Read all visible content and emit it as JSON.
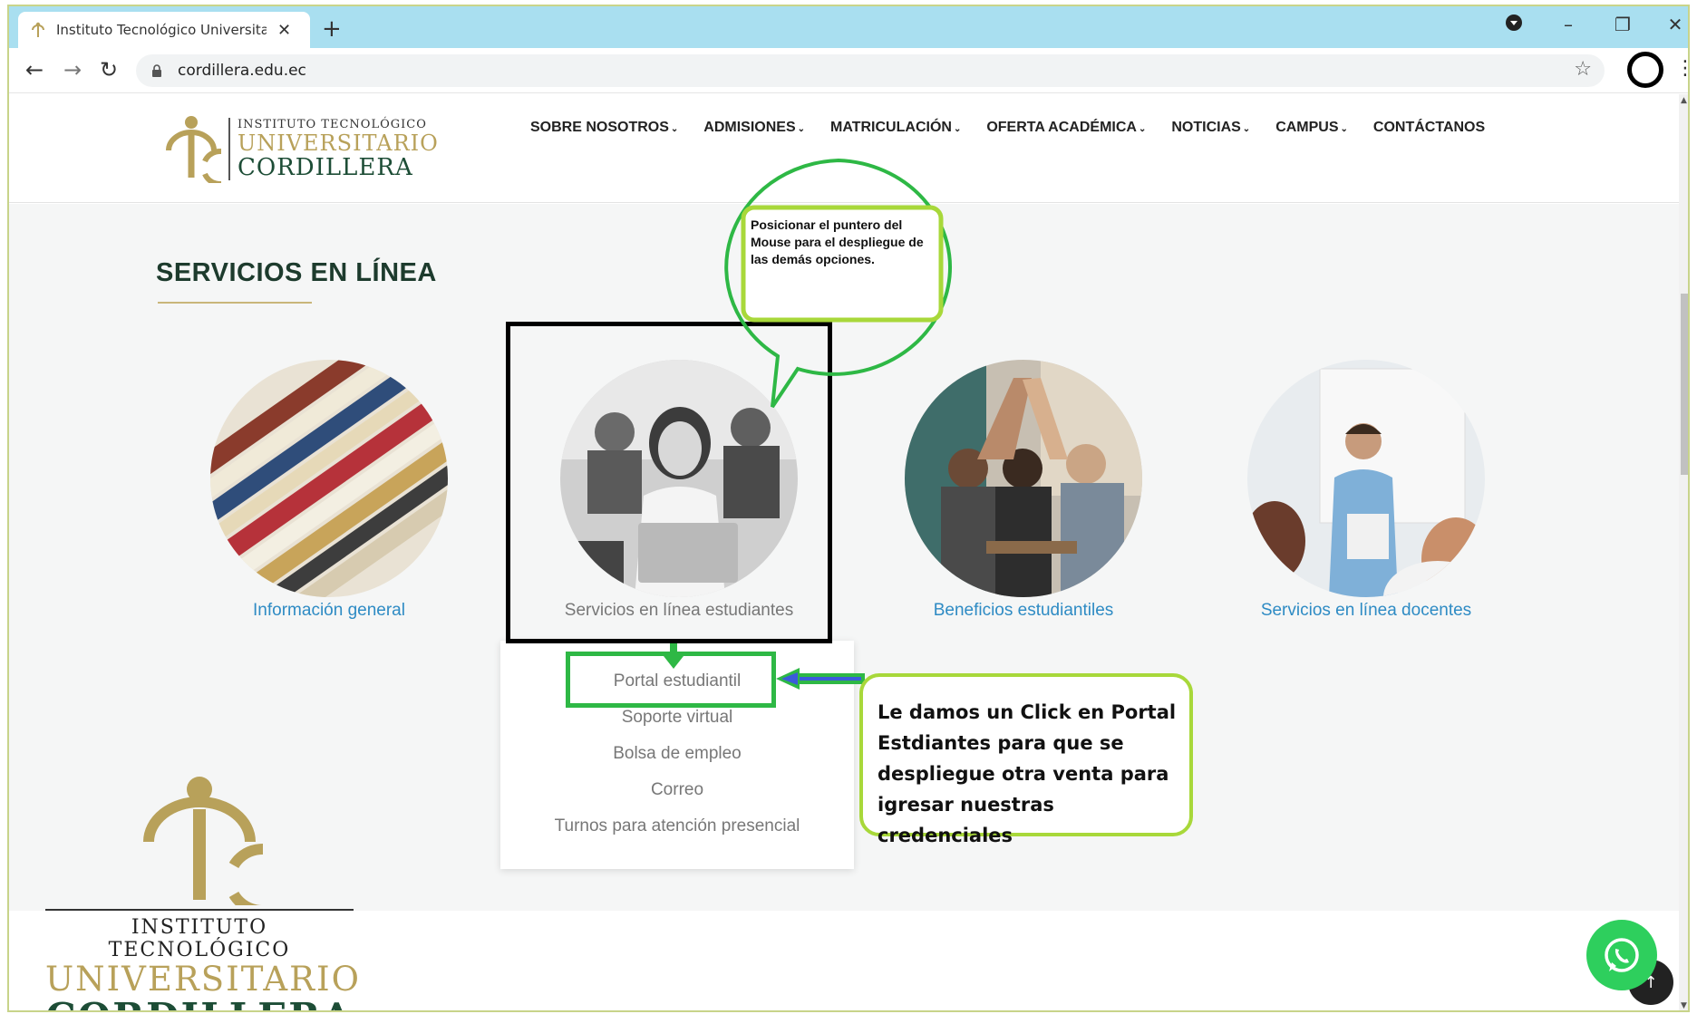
{
  "browser": {
    "tab_title": "Instituto Tecnológico Universitari",
    "tab_close": "✕",
    "new_tab": "+",
    "url": "cordillera.edu.ec",
    "nav_back": "←",
    "nav_forward": "→",
    "nav_reload": "↻",
    "star": "☆",
    "kebab": "⋮",
    "minimize": "–",
    "restore": "❐",
    "close": "✕",
    "colors": {
      "tabbar": "#a9dff0"
    }
  },
  "header": {
    "logo_line1": "INSTITUTO TECNOLÓGICO",
    "logo_line2": "UNIVERSITARIO",
    "logo_line3": "CORDILLERA",
    "nav": [
      {
        "label": "SOBRE NOSOTROS",
        "has_caret": true
      },
      {
        "label": "ADMISIONES",
        "has_caret": true
      },
      {
        "label": "MATRICULACIÓN",
        "has_caret": true
      },
      {
        "label": "OFERTA ACADÉMICA",
        "has_caret": true
      },
      {
        "label": "NOTICIAS",
        "has_caret": true
      },
      {
        "label": "CAMPUS",
        "has_caret": true
      },
      {
        "label": "CONTÁCTANOS",
        "has_caret": false
      }
    ],
    "caret": "⌄"
  },
  "section": {
    "title": "SERVICIOS EN LÍNEA",
    "cards": [
      {
        "label": "Información general",
        "icon": "books-photo"
      },
      {
        "label": "Servicios en línea estudiantes",
        "icon": "student-laptop-photo"
      },
      {
        "label": "Beneficios estudiantiles",
        "icon": "students-highfive-photo"
      },
      {
        "label": "Servicios en línea docentes",
        "icon": "teacher-photo"
      }
    ]
  },
  "dropdown": {
    "items": [
      "Portal estudiantil",
      "Soporte virtual",
      "Bolsa de empleo",
      "Correo",
      "Turnos para atención presencial"
    ]
  },
  "annotations": {
    "bubble_text": "Posicionar el puntero del Mouse para el despliegue de las demás opciones.",
    "note_text": "Le damos un Click en Portal Estdiantes para  que se despliegue  otra venta para igresar nuestras credenciales",
    "colors": {
      "black_box": "#000000",
      "green_box": "#2eb845",
      "note_border": "#a8d83a"
    }
  },
  "footer_logo": {
    "line1": "INSTITUTO TECNOLÓGICO",
    "line2": "UNIVERSITARIO",
    "line3": "CORDILLERA"
  },
  "widgets": {
    "to_top": "↑"
  }
}
